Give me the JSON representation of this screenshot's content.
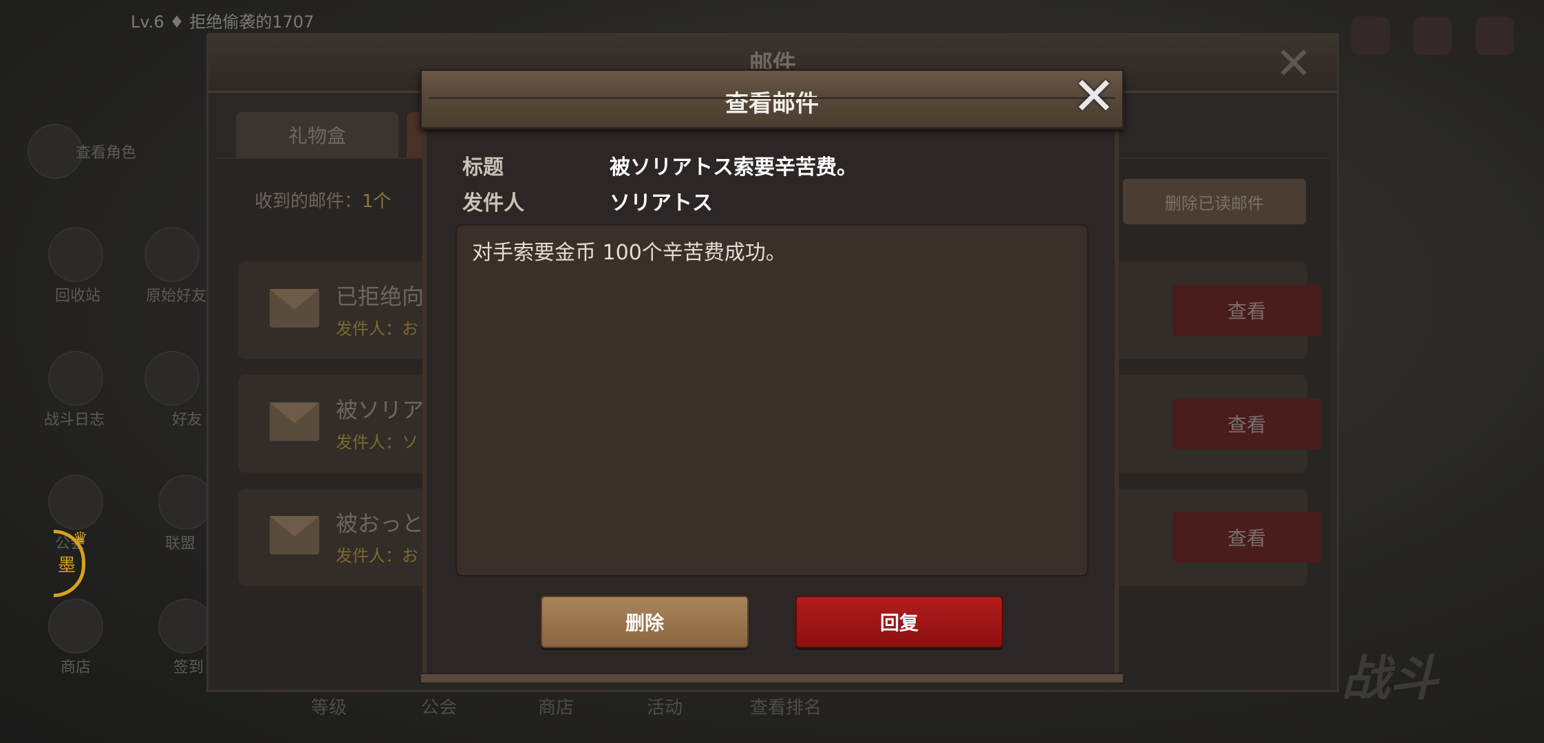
{
  "background": {
    "player_line": "Lv.6 ♦ 拒绝偷袭的1707",
    "left_menu": [
      "查看角色",
      "回收站",
      "原始好友",
      "战斗日志",
      "好友",
      "公会",
      "联盟",
      "商店",
      "签到"
    ],
    "bottom_tabs": [
      "等级",
      "公会",
      "商店",
      "活动",
      "查看排名"
    ],
    "badge_char": "墨",
    "battle_text": "战斗"
  },
  "mail_window": {
    "title": "邮件",
    "tabs": [
      "礼物盒",
      ""
    ],
    "received_label": "收到的邮件：",
    "received_count": "1个",
    "delete_read_label": "删除已读邮件",
    "rows": [
      {
        "subject": "已拒绝向",
        "sender_label": "发件人：",
        "sender_value": "お",
        "view_label": "查看"
      },
      {
        "subject": "被ソリアトス",
        "sender_label": "发件人：",
        "sender_value": "ソ",
        "view_label": "查看"
      },
      {
        "subject": "被おっと",
        "sender_label": "发件人：",
        "sender_value": "お",
        "view_label": "查看"
      }
    ]
  },
  "dialog": {
    "title": "查看邮件",
    "subject_label": "标题",
    "subject_value": "被ソリアトス索要辛苦费。",
    "sender_label": "发件人",
    "sender_value": "ソリアトス",
    "message": "对手索要金币 100个辛苦费成功。",
    "delete_label": "删除",
    "reply_label": "回复"
  },
  "colors": {
    "reply_button": "#9a1212",
    "delete_button": "#9a734c",
    "header_wood": "#5a4a3c"
  },
  "icons": [
    "close-icon",
    "envelope-icon",
    "envelope-open-icon"
  ]
}
